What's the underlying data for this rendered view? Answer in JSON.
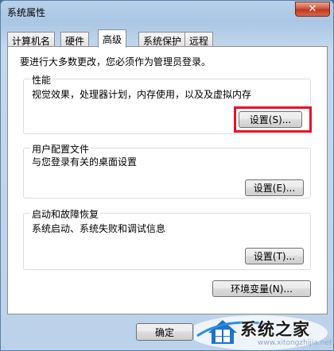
{
  "window": {
    "title": "系统属性"
  },
  "tabs": [
    {
      "label": "计算机名",
      "active": false
    },
    {
      "label": "硬件",
      "active": false
    },
    {
      "label": "高级",
      "active": true
    },
    {
      "label": "系统保护",
      "active": false
    },
    {
      "label": "远程",
      "active": false
    }
  ],
  "advanced": {
    "intro": "要进行大多数更改，您必须作为管理员登录。",
    "performance": {
      "label": "性能",
      "description": "视觉效果，处理器计划，内存使用，以及及虚拟内存",
      "button": "设置(S)..."
    },
    "user_profiles": {
      "label": "用户配置文件",
      "description": "与您登录有关的桌面设置",
      "button": "设置(E)..."
    },
    "startup_recovery": {
      "label": "启动和故障恢复",
      "description": "系统启动、系统失败和调试信息",
      "button": "设置(T)..."
    },
    "env_button": "环境变量(N)..."
  },
  "footer": {
    "ok_label": "确定"
  },
  "watermark": {
    "text": "系统之家",
    "url": "www.xitongzhijia.net"
  },
  "colors": {
    "highlight": "#e8102a",
    "close_button": "#c0361f"
  }
}
